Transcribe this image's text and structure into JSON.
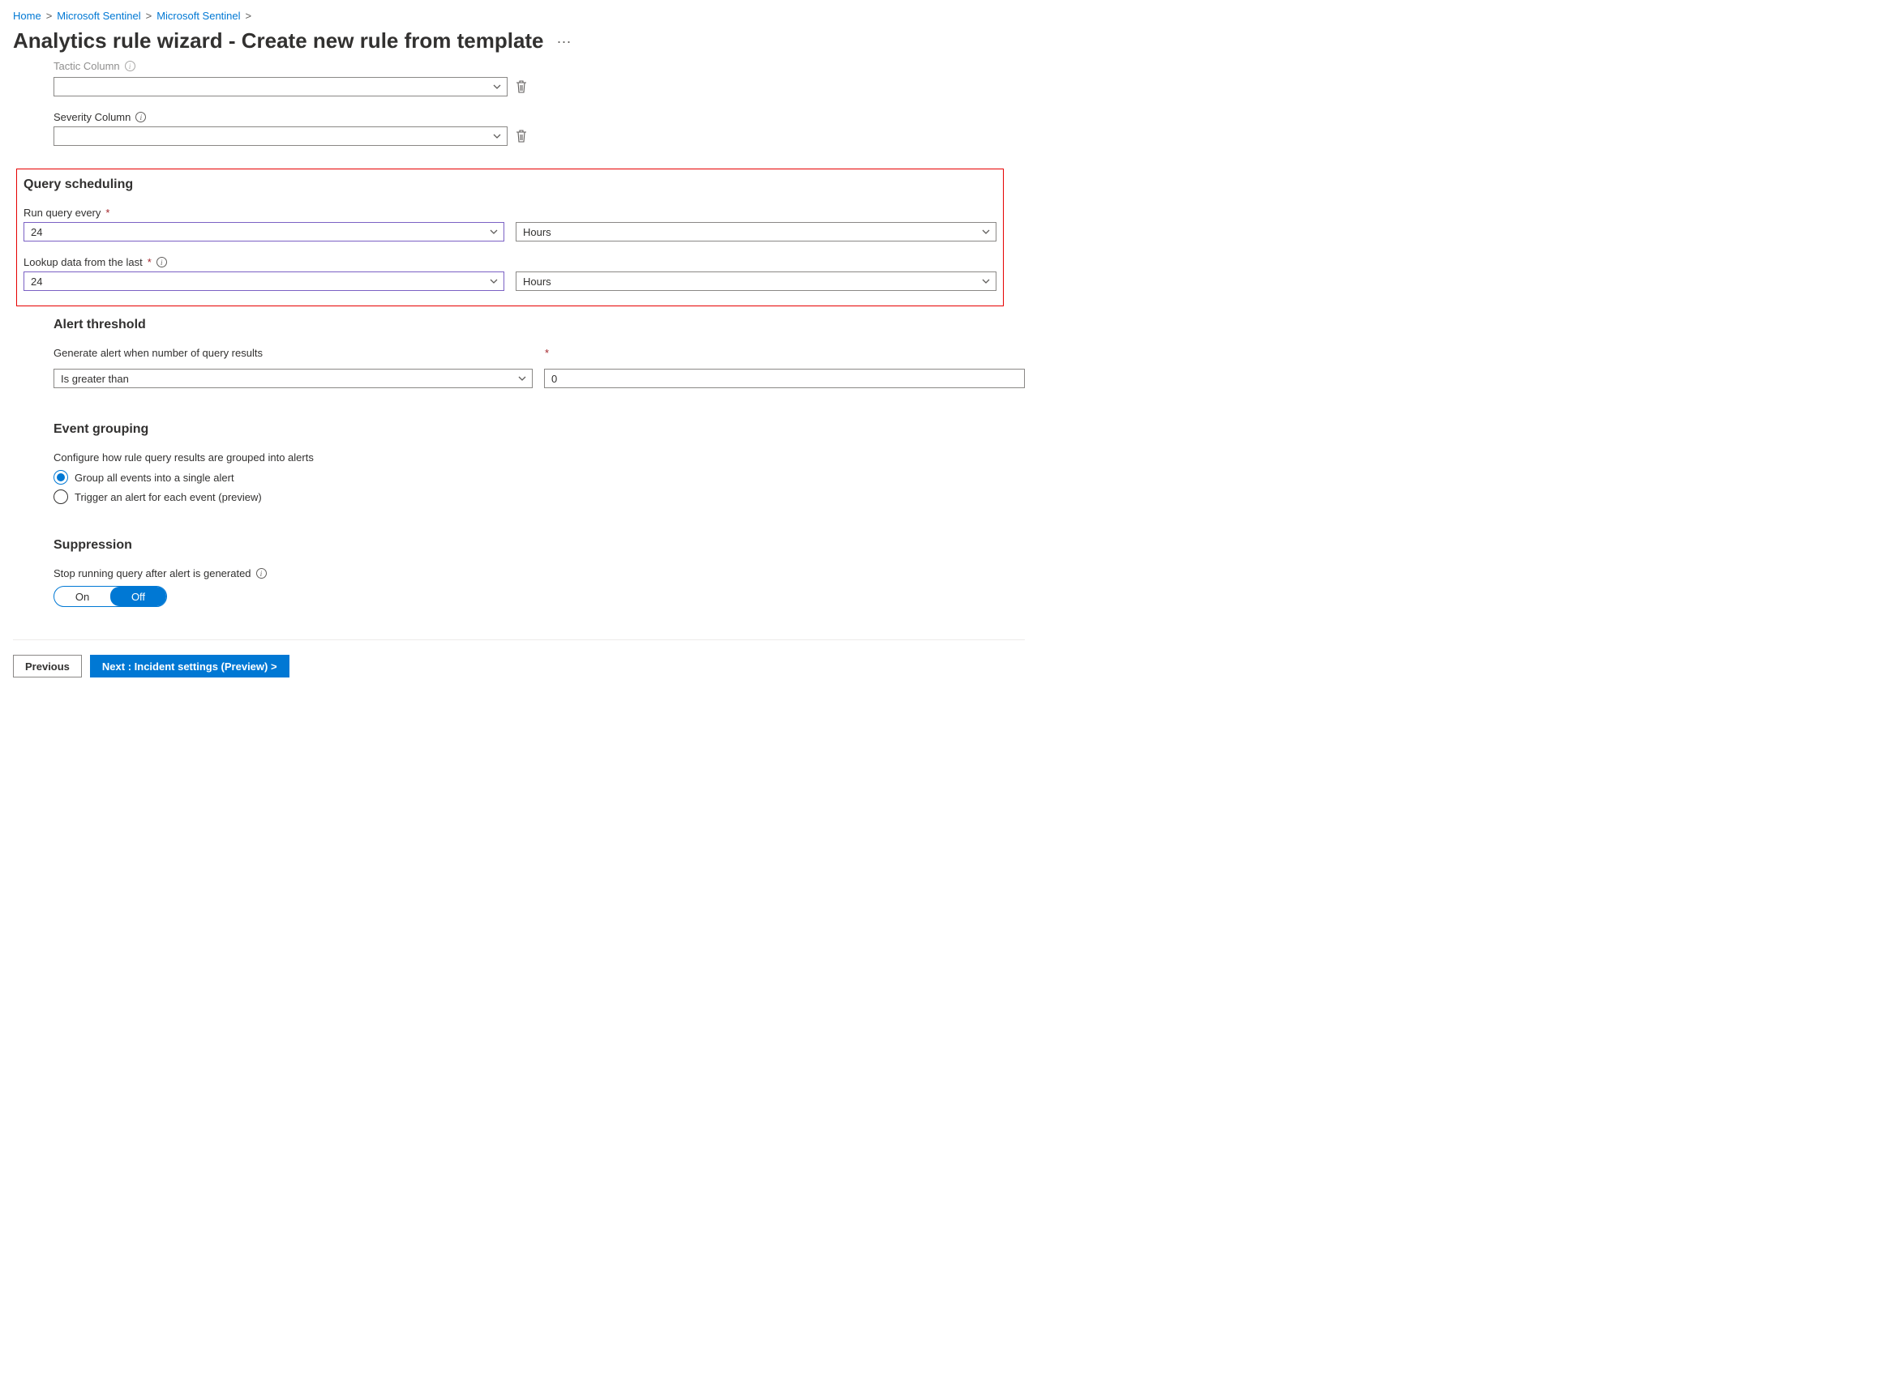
{
  "breadcrumb": {
    "home": "Home",
    "s1": "Microsoft Sentinel",
    "s2": "Microsoft Sentinel"
  },
  "page_title": "Analytics rule wizard - Create new rule from template",
  "top": {
    "tactic_label": "Tactic Column",
    "severity_label": "Severity Column"
  },
  "sched": {
    "heading": "Query scheduling",
    "run_label": "Run query every",
    "run_value": "24",
    "run_unit": "Hours",
    "lookup_label": "Lookup data from the last",
    "lookup_value": "24",
    "lookup_unit": "Hours"
  },
  "threshold": {
    "heading": "Alert threshold",
    "desc": "Generate alert when number of query results",
    "operator": "Is greater than",
    "value": "0"
  },
  "grouping": {
    "heading": "Event grouping",
    "desc": "Configure how rule query results are grouped into alerts",
    "opt1": "Group all events into a single alert",
    "opt2": "Trigger an alert for each event (preview)"
  },
  "supp": {
    "heading": "Suppression",
    "desc": "Stop running query after alert is generated",
    "on": "On",
    "off": "Off"
  },
  "footer": {
    "prev": "Previous",
    "next": "Next : Incident settings (Preview) >"
  }
}
